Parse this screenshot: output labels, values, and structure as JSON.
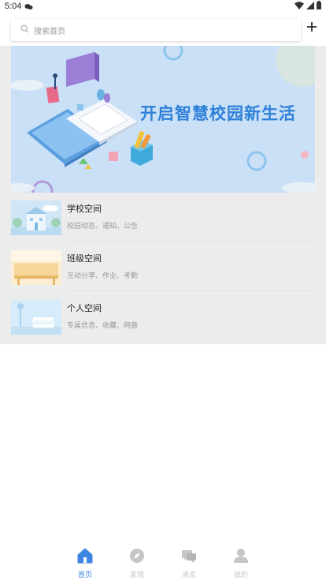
{
  "status_bar": {
    "time": "5:04"
  },
  "search": {
    "placeholder": "搜索首页"
  },
  "banner": {
    "title": "开启智慧校园新生活"
  },
  "list": [
    {
      "title": "学校空间",
      "subtitle": "校园动态、通知、公告"
    },
    {
      "title": "班级空间",
      "subtitle": "互动分享、作业、考勤"
    },
    {
      "title": "个人空间",
      "subtitle": "专属信息、收藏、网盘"
    }
  ],
  "nav": [
    {
      "label": "首页",
      "icon": "home-icon",
      "active": true
    },
    {
      "label": "发现",
      "icon": "compass-icon",
      "active": false
    },
    {
      "label": "消息",
      "icon": "chat-icon",
      "active": false
    },
    {
      "label": "我的",
      "icon": "person-icon",
      "active": false
    }
  ],
  "colors": {
    "accent": "#3f86e0",
    "banner_bg": "#c9e0f6",
    "banner_text": "#2f80d8",
    "section_bg": "#ececec",
    "inactive": "#c6c6c6"
  }
}
